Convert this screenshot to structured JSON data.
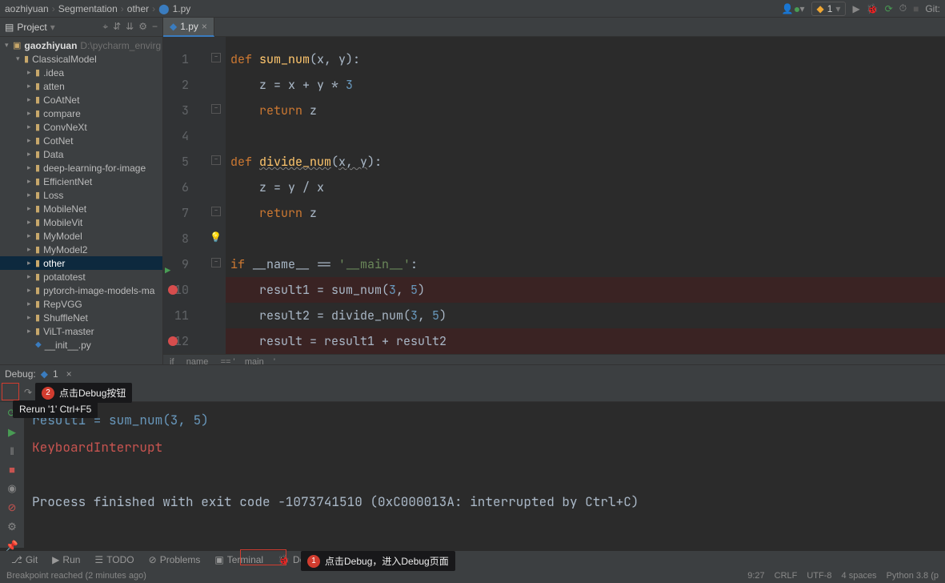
{
  "breadcrumbs": [
    "aozhiyuan",
    "Segmentation",
    "other",
    "1.py"
  ],
  "run_config": {
    "name": "1"
  },
  "topbar_git_label": "Git:",
  "project_panel": {
    "title": "Project",
    "root": {
      "name": "gaozhiyuan",
      "hint": "D:\\pycharm_envirg"
    },
    "tree": [
      {
        "name": "ClassicalModel",
        "depth": 1
      },
      {
        "name": ".idea",
        "depth": 2
      },
      {
        "name": "atten",
        "depth": 2
      },
      {
        "name": "CoAtNet",
        "depth": 2
      },
      {
        "name": "compare",
        "depth": 2
      },
      {
        "name": "ConvNeXt",
        "depth": 2
      },
      {
        "name": "CotNet",
        "depth": 2
      },
      {
        "name": "Data",
        "depth": 2
      },
      {
        "name": "deep-learning-for-image",
        "depth": 2
      },
      {
        "name": "EfficientNet",
        "depth": 2
      },
      {
        "name": "Loss",
        "depth": 2
      },
      {
        "name": "MobileNet",
        "depth": 2
      },
      {
        "name": "MobileVit",
        "depth": 2
      },
      {
        "name": "MyModel",
        "depth": 2
      },
      {
        "name": "MyModel2",
        "depth": 2
      },
      {
        "name": "other",
        "depth": 2,
        "selected": true
      },
      {
        "name": "potatotest",
        "depth": 2
      },
      {
        "name": "pytorch-image-models-ma",
        "depth": 2
      },
      {
        "name": "RepVGG",
        "depth": 2
      },
      {
        "name": "ShuffleNet",
        "depth": 2
      },
      {
        "name": "ViLT-master",
        "depth": 2
      },
      {
        "name": "__init__.py",
        "depth": 2,
        "file": true
      }
    ]
  },
  "editor": {
    "tab_name": "1.py",
    "context_hint": "if __name__ == '__main__'",
    "code_lines": [
      {
        "n": 1,
        "tokens": [
          [
            "kw",
            "def "
          ],
          [
            "fn",
            "sum_num"
          ],
          [
            "op",
            "(x, y):"
          ]
        ],
        "fold": true
      },
      {
        "n": 2,
        "tokens": [
          [
            "op",
            "    z = x + y * "
          ],
          [
            "num",
            "3"
          ]
        ]
      },
      {
        "n": 3,
        "tokens": [
          [
            "op",
            "    "
          ],
          [
            "kw",
            "return"
          ],
          [
            "op",
            " z"
          ]
        ],
        "fold": true
      },
      {
        "n": 4,
        "tokens": [
          [
            "op",
            ""
          ]
        ]
      },
      {
        "n": 5,
        "tokens": [
          [
            "kw",
            "def "
          ],
          [
            "fn underwave",
            "divide_num"
          ],
          [
            "op",
            "("
          ],
          [
            "op underwave",
            "x, y"
          ],
          [
            "op",
            "):"
          ]
        ],
        "fold": true
      },
      {
        "n": 6,
        "tokens": [
          [
            "op",
            "    z = y / x"
          ]
        ]
      },
      {
        "n": 7,
        "tokens": [
          [
            "op",
            "    "
          ],
          [
            "kw",
            "return"
          ],
          [
            "op",
            " z"
          ]
        ],
        "fold": true
      },
      {
        "n": 8,
        "tokens": [
          [
            "op",
            ""
          ]
        ],
        "bulb": true
      },
      {
        "n": 9,
        "tokens": [
          [
            "kw",
            "if"
          ],
          [
            "op",
            " __name__ == "
          ],
          [
            "str",
            "'__main__'"
          ],
          [
            "op",
            ":"
          ]
        ],
        "run": true,
        "fold": true
      },
      {
        "n": 10,
        "tokens": [
          [
            "op",
            "    result1 = sum_num("
          ],
          [
            "num",
            "3"
          ],
          [
            "op",
            ", "
          ],
          [
            "num",
            "5"
          ],
          [
            "op",
            ")"
          ]
        ],
        "bp": true
      },
      {
        "n": 11,
        "tokens": [
          [
            "op",
            "    result2 = divide_num("
          ],
          [
            "num",
            "3"
          ],
          [
            "op",
            ", "
          ],
          [
            "num",
            "5"
          ],
          [
            "op",
            ")"
          ]
        ]
      },
      {
        "n": 12,
        "tokens": [
          [
            "op",
            "    result = result1 + result2"
          ]
        ],
        "bp": true
      }
    ]
  },
  "debug_panel": {
    "title": "Debug:",
    "tab": "1",
    "console_lines": [
      {
        "cls": "call",
        "text": "  result1 = sum_num(3, 5)"
      },
      {
        "cls": "err",
        "text": "KeyboardInterrupt"
      },
      {
        "cls": "",
        "text": ""
      },
      {
        "cls": "",
        "text": "Process finished with exit code -1073741510 (0xC000013A: interrupted by Ctrl+C)"
      }
    ]
  },
  "callouts": {
    "rerun_tooltip": "Rerun '1'  Ctrl+F5",
    "c2_text": "点击Debug按钮",
    "c1_text": "点击Debug，进入Debug页面"
  },
  "toolwins": [
    "Git",
    "Run",
    "TODO",
    "Problems",
    "Terminal",
    "Debug"
  ],
  "status": {
    "left": "Breakpoint reached (2 minutes ago)",
    "pos": "9:27",
    "eol": "CRLF",
    "enc": "UTF-8",
    "indent": "4 spaces",
    "interp": "Python 3.8 (p"
  }
}
